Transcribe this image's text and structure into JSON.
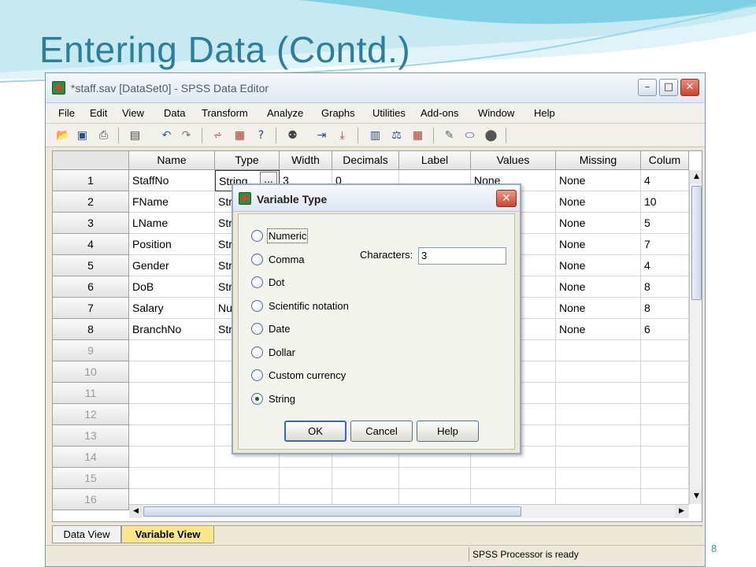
{
  "slide": {
    "title": "Entering Data (Contd.)",
    "number": "8"
  },
  "window": {
    "title": "*staff.sav [DataSet0] - SPSS Data Editor",
    "min": "–",
    "max": "□",
    "close": "✕"
  },
  "menu": [
    "File",
    "Edit",
    "View",
    "Data",
    "Transform",
    "Analyze",
    "Graphs",
    "Utilities",
    "Add-ons",
    "Window",
    "Help"
  ],
  "toolbar": [
    "open-icon",
    "save-icon",
    "print-icon",
    "dialog-recall-icon",
    "undo-icon",
    "redo-icon",
    "goto-case-icon",
    "goto-variable-icon",
    "variables-icon",
    "find-icon",
    "insert-cases-icon",
    "insert-variable-icon",
    "split-file-icon",
    "weight-cases-icon",
    "select-cases-icon",
    "value-labels-icon",
    "use-sets-icon",
    "show-all-icon"
  ],
  "columns": [
    "Name",
    "Type",
    "Width",
    "Decimals",
    "Label",
    "Values",
    "Missing",
    "Colum"
  ],
  "row_numbers": [
    "1",
    "2",
    "3",
    "4",
    "5",
    "6",
    "7",
    "8",
    "9",
    "10",
    "11",
    "12",
    "13",
    "14",
    "15",
    "16"
  ],
  "rows": [
    [
      "StaffNo",
      "String",
      "3",
      "0",
      "",
      "None",
      "None",
      "4"
    ],
    [
      "FName",
      "Str",
      "",
      "",
      "",
      "",
      "None",
      "10"
    ],
    [
      "LName",
      "Str",
      "",
      "",
      "",
      "",
      "None",
      "5"
    ],
    [
      "Position",
      "Str",
      "",
      "",
      "",
      "",
      "None",
      "7"
    ],
    [
      "Gender",
      "Str",
      "",
      "",
      "",
      "",
      "None",
      "4"
    ],
    [
      "DoB",
      "Str",
      "",
      "",
      "",
      "",
      "None",
      "8"
    ],
    [
      "Salary",
      "Nu",
      "",
      "",
      "",
      "",
      "None",
      "8"
    ],
    [
      "BranchNo",
      "Str",
      "",
      "",
      "",
      "",
      "None",
      "6"
    ]
  ],
  "cell_button": "...",
  "tabs": {
    "data_view": "Data View",
    "variable_view": "Variable View"
  },
  "status": "SPSS  Processor is ready",
  "dialog": {
    "title": "Variable Type",
    "close": "✕",
    "options": [
      "Numeric",
      "Comma",
      "Dot",
      "Scientific notation",
      "Date",
      "Dollar",
      "Custom currency",
      "String"
    ],
    "selected": "String",
    "characters_label": "Characters:",
    "characters_value": "3",
    "ok": "OK",
    "cancel": "Cancel",
    "help": "Help"
  },
  "colors": {
    "title_teal": "#2d7f99",
    "active_tab": "#fbe68a",
    "close_red": "#c9462f"
  }
}
